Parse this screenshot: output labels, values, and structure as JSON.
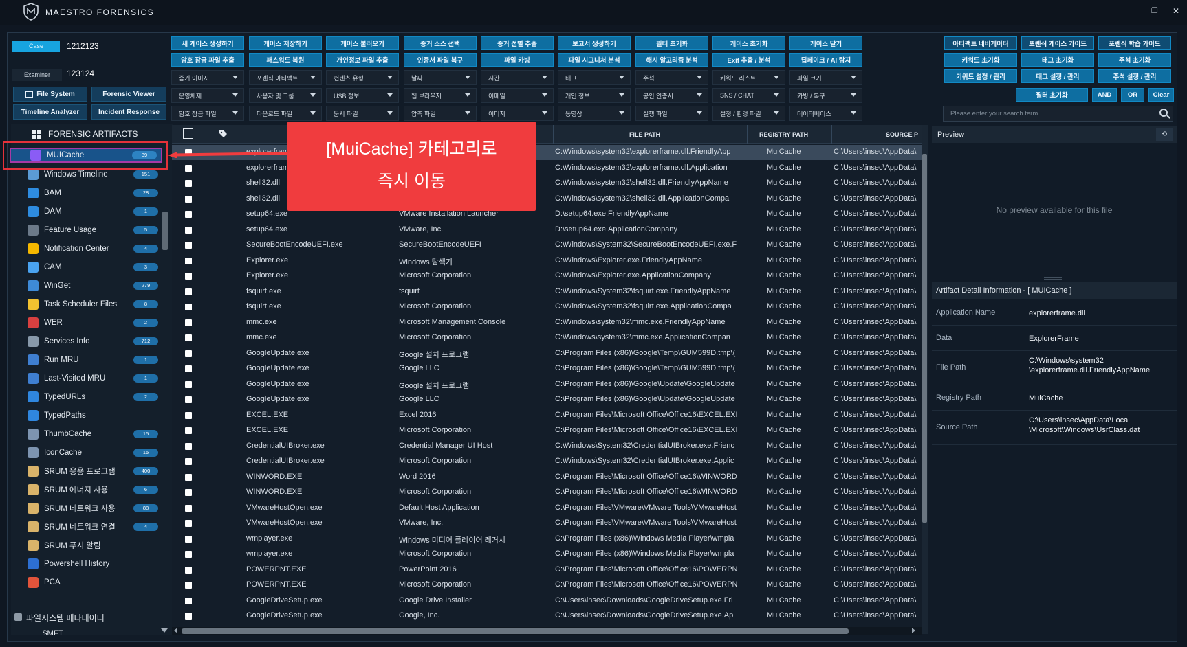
{
  "app": {
    "title": "MAESTRO FORENSICS",
    "minimize": "–",
    "restore": "❐",
    "close": "✕"
  },
  "case": {
    "case_label": "Case",
    "case_value": "1212123",
    "examiner_label": "Examiner",
    "examiner_value": "123124"
  },
  "nav": {
    "file_system": "File System",
    "forensic_viewer": "Forensic Viewer",
    "timeline_analyzer": "Timeline Analyzer",
    "incident_response": "Incident Response"
  },
  "actions_row1": [
    "새 케이스 생성하기",
    "케이스 저장하기",
    "케이스 불러오기",
    "증거 소스 선택",
    "증거 선별 추출",
    "보고서 생성하기",
    "필터 초기화",
    "케이스 초기화",
    "케이스 닫기"
  ],
  "actions_row2": [
    "암호 잠금 파일 추출",
    "패스워드 복원",
    "개인정보 파일 추출",
    "인증서 파일 복구",
    "파일 카빙",
    "파일 시그니처 분석",
    "해시 알고리즘 분석",
    "Exif 추출 / 분석",
    "딥페이크 / AI 탐지"
  ],
  "filters_row1": [
    "증거 이미지",
    "포렌식 아티팩트",
    "컨텐츠 유형",
    "날짜",
    "시간",
    "태그",
    "주석",
    "키워드 리스트",
    "파일 크기"
  ],
  "filters_row2": [
    "운영체제",
    "사용자 및 그룹",
    "USB 정보",
    "웹 브라우저",
    "이메일",
    "개인 정보",
    "공인 인증서",
    "SNS / CHAT",
    "카빙 / 복구"
  ],
  "filters_row3": [
    "암호 잠금 파일",
    "다운로드 파일",
    "문서 파일",
    "압축 파일",
    "이미지",
    "동영상",
    "실행 파일",
    "설정 / 환경 파일",
    "데이터베이스"
  ],
  "right_actions_row1": [
    "아티팩트 네비게이터",
    "포렌식 케이스 가이드",
    "포렌식 학습 가이드"
  ],
  "right_actions_row2": [
    "키워드 초기화",
    "태그 초기화",
    "주석 초기화"
  ],
  "right_actions_row3": [
    "키워드 설정 / 관리",
    "태그 설정 / 관리",
    "주석 설정 / 관리"
  ],
  "search_bar": {
    "filter_reset": "필터 초기화",
    "and": "AND",
    "or": "OR",
    "clear": "Clear",
    "placeholder": "Please enter your search term"
  },
  "sidebar": {
    "header": "FORENSIC ARTIFACTS",
    "items": [
      {
        "label": "MUICache",
        "count": "39",
        "color": "#8a5cf5"
      },
      {
        "label": "Windows Timeline",
        "count": "151",
        "color": "#5b9bd5"
      },
      {
        "label": "BAM",
        "count": "28",
        "color": "#2e8ce0"
      },
      {
        "label": "DAM",
        "count": "1",
        "color": "#2e8ce0"
      },
      {
        "label": "Feature Usage",
        "count": "5",
        "color": "#6c7a89"
      },
      {
        "label": "Notification Center",
        "count": "4",
        "color": "#f5b800"
      },
      {
        "label": "CAM",
        "count": "3",
        "color": "#4aa3f0"
      },
      {
        "label": "WinGet",
        "count": "279",
        "color": "#3e8ad6"
      },
      {
        "label": "Task Scheduler Files",
        "count": "8",
        "color": "#f2c230"
      },
      {
        "label": "WER",
        "count": "2",
        "color": "#d84040"
      },
      {
        "label": "Services Info",
        "count": "712",
        "color": "#8899aa"
      },
      {
        "label": "Run MRU",
        "count": "1",
        "color": "#3f7fd1"
      },
      {
        "label": "Last-Visited MRU",
        "count": "1",
        "color": "#3f7fd1"
      },
      {
        "label": "TypedURLs",
        "count": "2",
        "color": "#2f86de"
      },
      {
        "label": "TypedPaths",
        "count": "",
        "color": "#2f86de"
      },
      {
        "label": "ThumbCache",
        "count": "15",
        "color": "#7d94b0"
      },
      {
        "label": "IconCache",
        "count": "15",
        "color": "#7d94b0"
      },
      {
        "label": "SRUM 응용 프로그램",
        "count": "400",
        "color": "#d9b36a"
      },
      {
        "label": "SRUM 에너지 사용",
        "count": "6",
        "color": "#d9b36a"
      },
      {
        "label": "SRUM 네트워크 사용",
        "count": "88",
        "color": "#d9b36a"
      },
      {
        "label": "SRUM 네트워크 연결",
        "count": "4",
        "color": "#d9b36a"
      },
      {
        "label": "SRUM 푸시 알림",
        "count": "",
        "color": "#d9b36a"
      },
      {
        "label": "Powershell History",
        "count": "",
        "color": "#2d6fd1"
      },
      {
        "label": "PCA",
        "count": "",
        "color": "#e2543b"
      }
    ],
    "section": "파일시스템 메타데이터",
    "section_item": "$MFT"
  },
  "table": {
    "headers": [
      "FILE PATH",
      "REGISTRY PATH",
      "SOURCE P"
    ],
    "rows": [
      [
        "explorerfram",
        "",
        "C:\\Windows\\system32\\explorerframe.dll.FriendlyApp",
        "MuiCache",
        "C:\\Users\\insec\\AppData\\"
      ],
      [
        "explorerfram",
        "",
        "C:\\Windows\\system32\\explorerframe.dll.Application",
        "MuiCache",
        "C:\\Users\\insec\\AppData\\"
      ],
      [
        "shell32.dll",
        "",
        "C:\\Windows\\system32\\shell32.dll.FriendlyAppName",
        "MuiCache",
        "C:\\Users\\insec\\AppData\\"
      ],
      [
        "shell32.dll",
        "",
        "C:\\Windows\\system32\\shell32.dll.ApplicationCompa",
        "MuiCache",
        "C:\\Users\\insec\\AppData\\"
      ],
      [
        "setup64.exe",
        "VMware Installation Launcher",
        "D:\\setup64.exe.FriendlyAppName",
        "MuiCache",
        "C:\\Users\\insec\\AppData\\"
      ],
      [
        "setup64.exe",
        "VMware, Inc.",
        "D:\\setup64.exe.ApplicationCompany",
        "MuiCache",
        "C:\\Users\\insec\\AppData\\"
      ],
      [
        "SecureBootEncodeUEFI.exe",
        "SecureBootEncodeUEFI",
        "C:\\Windows\\System32\\SecureBootEncodeUEFI.exe.F",
        "MuiCache",
        "C:\\Users\\insec\\AppData\\"
      ],
      [
        "Explorer.exe",
        "Windows 탐색기",
        "C:\\Windows\\Explorer.exe.FriendlyAppName",
        "MuiCache",
        "C:\\Users\\insec\\AppData\\"
      ],
      [
        "Explorer.exe",
        "Microsoft Corporation",
        "C:\\Windows\\Explorer.exe.ApplicationCompany",
        "MuiCache",
        "C:\\Users\\insec\\AppData\\"
      ],
      [
        "fsquirt.exe",
        "fsquirt",
        "C:\\Windows\\System32\\fsquirt.exe.FriendlyAppName",
        "MuiCache",
        "C:\\Users\\insec\\AppData\\"
      ],
      [
        "fsquirt.exe",
        "Microsoft Corporation",
        "C:\\Windows\\System32\\fsquirt.exe.ApplicationCompa",
        "MuiCache",
        "C:\\Users\\insec\\AppData\\"
      ],
      [
        "mmc.exe",
        "Microsoft Management Console",
        "C:\\Windows\\system32\\mmc.exe.FriendlyAppName",
        "MuiCache",
        "C:\\Users\\insec\\AppData\\"
      ],
      [
        "mmc.exe",
        "Microsoft Corporation",
        "C:\\Windows\\system32\\mmc.exe.ApplicationCompan",
        "MuiCache",
        "C:\\Users\\insec\\AppData\\"
      ],
      [
        "GoogleUpdate.exe",
        "Google 설치 프로그램",
        "C:\\Program Files (x86)\\Google\\Temp\\GUM599D.tmp\\(",
        "MuiCache",
        "C:\\Users\\insec\\AppData\\"
      ],
      [
        "GoogleUpdate.exe",
        "Google LLC",
        "C:\\Program Files (x86)\\Google\\Temp\\GUM599D.tmp\\(",
        "MuiCache",
        "C:\\Users\\insec\\AppData\\"
      ],
      [
        "GoogleUpdate.exe",
        "Google 설치 프로그램",
        "C:\\Program Files (x86)\\Google\\Update\\GoogleUpdate",
        "MuiCache",
        "C:\\Users\\insec\\AppData\\"
      ],
      [
        "GoogleUpdate.exe",
        "Google LLC",
        "C:\\Program Files (x86)\\Google\\Update\\GoogleUpdate",
        "MuiCache",
        "C:\\Users\\insec\\AppData\\"
      ],
      [
        "EXCEL.EXE",
        "Excel 2016",
        "C:\\Program Files\\Microsoft Office\\Office16\\EXCEL.EXI",
        "MuiCache",
        "C:\\Users\\insec\\AppData\\"
      ],
      [
        "EXCEL.EXE",
        "Microsoft Corporation",
        "C:\\Program Files\\Microsoft Office\\Office16\\EXCEL.EXI",
        "MuiCache",
        "C:\\Users\\insec\\AppData\\"
      ],
      [
        "CredentialUIBroker.exe",
        "Credential Manager UI Host",
        "C:\\Windows\\System32\\CredentialUIBroker.exe.Frienc",
        "MuiCache",
        "C:\\Users\\insec\\AppData\\"
      ],
      [
        "CredentialUIBroker.exe",
        "Microsoft Corporation",
        "C:\\Windows\\System32\\CredentialUIBroker.exe.Applic",
        "MuiCache",
        "C:\\Users\\insec\\AppData\\"
      ],
      [
        "WINWORD.EXE",
        "Word 2016",
        "C:\\Program Files\\Microsoft Office\\Office16\\WINWORD",
        "MuiCache",
        "C:\\Users\\insec\\AppData\\"
      ],
      [
        "WINWORD.EXE",
        "Microsoft Corporation",
        "C:\\Program Files\\Microsoft Office\\Office16\\WINWORD",
        "MuiCache",
        "C:\\Users\\insec\\AppData\\"
      ],
      [
        "VMwareHostOpen.exe",
        "Default Host Application",
        "C:\\Program Files\\VMware\\VMware Tools\\VMwareHost",
        "MuiCache",
        "C:\\Users\\insec\\AppData\\"
      ],
      [
        "VMwareHostOpen.exe",
        "VMware, Inc.",
        "C:\\Program Files\\VMware\\VMware Tools\\VMwareHost",
        "MuiCache",
        "C:\\Users\\insec\\AppData\\"
      ],
      [
        "wmplayer.exe",
        "Windows 미디어 플레이어 레거시",
        "C:\\Program Files (x86)\\Windows Media Player\\wmpla",
        "MuiCache",
        "C:\\Users\\insec\\AppData\\"
      ],
      [
        "wmplayer.exe",
        "Microsoft Corporation",
        "C:\\Program Files (x86)\\Windows Media Player\\wmpla",
        "MuiCache",
        "C:\\Users\\insec\\AppData\\"
      ],
      [
        "POWERPNT.EXE",
        "PowerPoint 2016",
        "C:\\Program Files\\Microsoft Office\\Office16\\POWERPN",
        "MuiCache",
        "C:\\Users\\insec\\AppData\\"
      ],
      [
        "POWERPNT.EXE",
        "Microsoft Corporation",
        "C:\\Program Files\\Microsoft Office\\Office16\\POWERPN",
        "MuiCache",
        "C:\\Users\\insec\\AppData\\"
      ],
      [
        "GoogleDriveSetup.exe",
        "Google Drive Installer",
        "C:\\Users\\insec\\Downloads\\GoogleDriveSetup.exe.Fri",
        "MuiCache",
        "C:\\Users\\insec\\AppData\\"
      ],
      [
        "GoogleDriveSetup.exe",
        "Google, Inc.",
        "C:\\Users\\insec\\Downloads\\GoogleDriveSetup.exe.Ap",
        "MuiCache",
        "C:\\Users\\insec\\AppData\\"
      ]
    ]
  },
  "callout": {
    "line1": "[MuiCache] 카테고리로",
    "line2": "즉시 이동",
    "color": "#f03c3e"
  },
  "preview": {
    "header": "Preview",
    "refresh": "⟲",
    "empty": "No preview available for this file"
  },
  "detail": {
    "header": "Artifact Detail Information  -  [ MUICache ]",
    "rows": [
      {
        "key": "Application Name",
        "value": "explorerframe.dll"
      },
      {
        "key": "Data",
        "value": "ExplorerFrame"
      },
      {
        "key": "File Path",
        "value": "C:\\Windows\\system32\n\\explorerframe.dll.FriendlyAppName"
      },
      {
        "key": "Registry Path",
        "value": "MuiCache"
      },
      {
        "key": "Source Path",
        "value": "C:\\Users\\insec\\AppData\\Local\n\\Microsoft\\Windows\\UsrClass.dat"
      }
    ]
  }
}
